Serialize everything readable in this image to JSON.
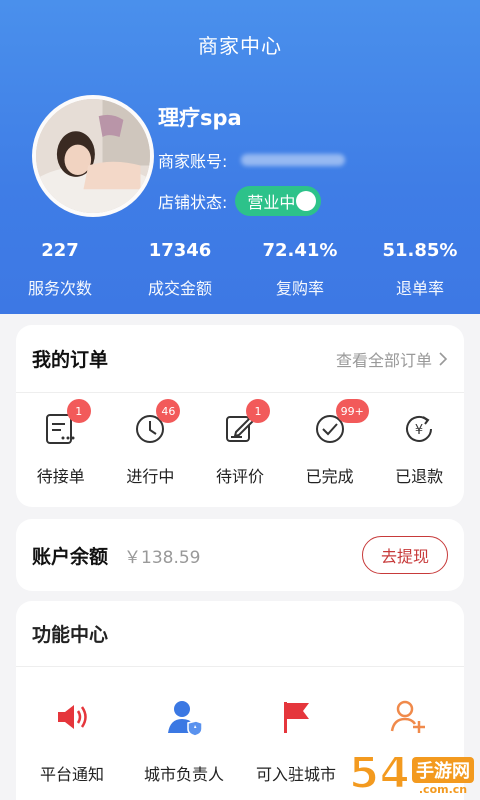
{
  "header": {
    "title": "商家中心",
    "shop_name": "理疗spa",
    "account_label": "商家账号:",
    "status_label": "店铺状态:",
    "status_value": "营业中"
  },
  "stats": [
    {
      "value": "227",
      "label": "服务次数"
    },
    {
      "value": "17346",
      "label": "成交金额"
    },
    {
      "value": "72.41%",
      "label": "复购率"
    },
    {
      "value": "51.85%",
      "label": "退单率"
    }
  ],
  "orders": {
    "title": "我的订单",
    "view_all": "查看全部订单",
    "items": [
      {
        "label": "待接单",
        "badge": "1",
        "icon": "pending-order-icon"
      },
      {
        "label": "进行中",
        "badge": "46",
        "icon": "clock-icon"
      },
      {
        "label": "待评价",
        "badge": "1",
        "icon": "edit-review-icon"
      },
      {
        "label": "已完成",
        "badge": "99+",
        "icon": "check-circle-icon"
      },
      {
        "label": "已退款",
        "badge": "",
        "icon": "refund-icon"
      }
    ]
  },
  "balance": {
    "title": "账户余额",
    "amount": "￥138.59",
    "withdraw_label": "去提现"
  },
  "functions": {
    "title": "功能中心",
    "items": [
      {
        "label": "平台通知",
        "icon": "speaker-icon"
      },
      {
        "label": "城市负责人",
        "icon": "city-manager-icon"
      },
      {
        "label": "可入驻城市",
        "icon": "flag-icon"
      },
      {
        "label": "",
        "icon": "add-user-icon"
      }
    ]
  },
  "watermark": {
    "number": "54",
    "cn": "手游网",
    "en": ".com.cn"
  },
  "colors": {
    "header_blue": "#3f7de6",
    "accent_red": "#c73a3a",
    "badge_red": "#f25a5a",
    "status_green": "#2dc28a"
  }
}
